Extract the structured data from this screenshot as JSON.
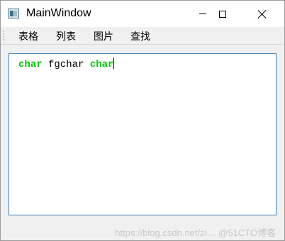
{
  "window": {
    "title": "MainWindow"
  },
  "menubar": {
    "items": [
      {
        "label": "表格"
      },
      {
        "label": "列表"
      },
      {
        "label": "图片"
      },
      {
        "label": "查找"
      }
    ]
  },
  "editor": {
    "tokens": [
      {
        "text": "char",
        "highlight": true
      },
      {
        "text": " fgchar ",
        "highlight": false
      },
      {
        "text": "char",
        "highlight": true
      }
    ],
    "highlight_color": "#00c800"
  },
  "watermark": {
    "text": "https://blog.csdn.net/zi… @51CTO博客"
  }
}
